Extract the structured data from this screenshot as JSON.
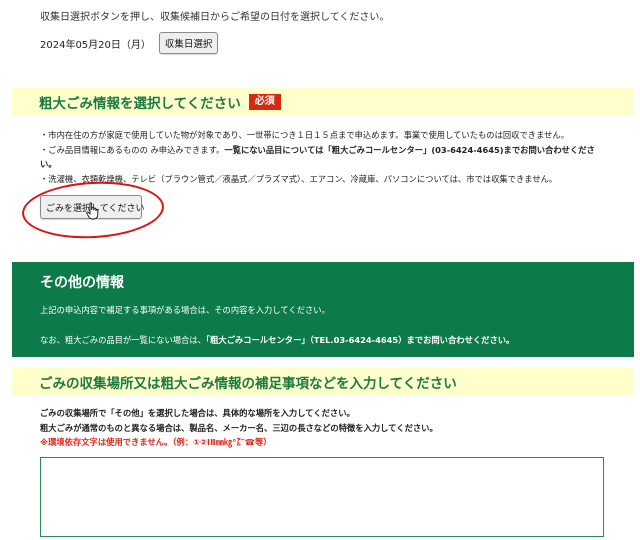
{
  "collection_date": {
    "instruction": "収集日選択ボタンを押し、収集候補日からご希望の日付を選択してください。",
    "selected_date": "2024年05月20日（月）",
    "select_button_label": "収集日選択"
  },
  "bulky_info": {
    "title": "粗大ごみ情報を選択してください",
    "required_label": "必須",
    "notes": [
      "・市内在住の方が家庭で使用していた物が対象であり、一世帯につき１日１５点まで申込めます。事業で使用していたものは回収できません。",
      "・ごみ品目情報にあるものの み申込みできます。",
      "一覧にない品目については「粗大ごみコールセンター」(03-6424-4645)までお問い合わせくださ",
      "い。",
      "・洗濯機、衣類乾燥機、テレビ（ブラウン管式／液晶式／プラズマ式）、エアコン、冷蔵庫、パソコンについては、市では収集できません。"
    ],
    "select_button_label": "ごみを選択してください"
  },
  "other_info": {
    "title": "その他の情報",
    "line1": "上記の申込内容で補足する事項がある場合は、その内容を入力してください。",
    "line2_prefix": "なお、粗大ごみの品目が一覧にない場合は、",
    "line2_bold": "「粗大ごみコールセンター」（TEL.03-6424-4645）までお問い合わせください。"
  },
  "supplement": {
    "title": "ごみの収集場所又は粗大ごみ情報の補足事項などを入力してください",
    "instructions": [
      "ごみの収集場所で「その他」を選択した場合は、具体的な場所を入力してください。",
      "粗大ごみが通常のものと異なる場合は、製品名、メーカー名、三辺の長さなどの特徴を入力してください。"
    ],
    "warning": "※環境依存文字は使用できません。（例：①②ⅠⅡ㎜㎏°㌃☎等）",
    "textarea_value": ""
  },
  "colors": {
    "accent_green": "#0d7a4a",
    "section_bar_bg": "#ffffcc",
    "required_red": "#d42a0f",
    "annotation_red": "#dd1111"
  }
}
